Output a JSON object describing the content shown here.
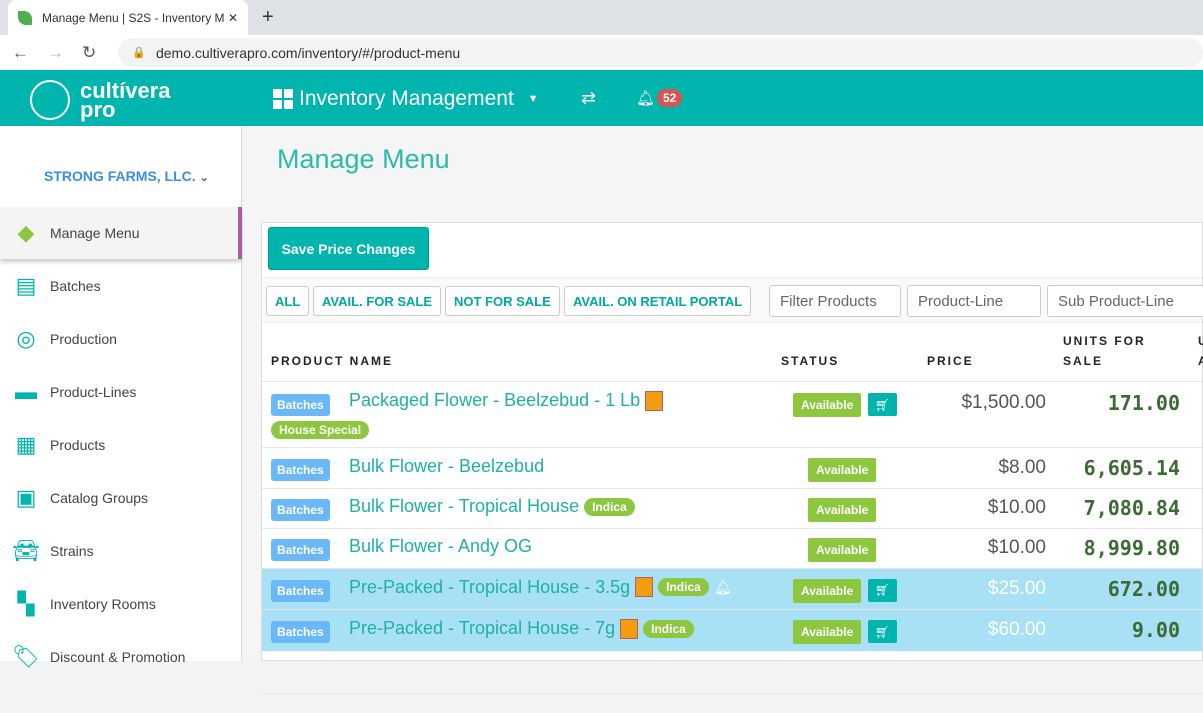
{
  "browser": {
    "tab_title": "Manage Menu | S2S - Inventory M",
    "url": "demo.cultiverapro.com/inventory/#/product-menu"
  },
  "header": {
    "logo_line1": "cultívera",
    "logo_line2": "pro",
    "app_name": "Inventory Management",
    "notification_count": "52"
  },
  "sidebar": {
    "company": "STRONG FARMS, LLC.",
    "items": [
      {
        "label": "Manage Menu",
        "icon": "tag-icon",
        "active": true
      },
      {
        "label": "Batches",
        "icon": "batches-icon"
      },
      {
        "label": "Production",
        "icon": "production-icon"
      },
      {
        "label": "Product-Lines",
        "icon": "product-lines-icon"
      },
      {
        "label": "Products",
        "icon": "products-grid-icon"
      },
      {
        "label": "Catalog Groups",
        "icon": "catalog-icon"
      },
      {
        "label": "Strains",
        "icon": "car-icon"
      },
      {
        "label": "Inventory Rooms",
        "icon": "rooms-icon"
      },
      {
        "label": "Discount & Promotion",
        "icon": "discount-tag-icon"
      }
    ]
  },
  "main": {
    "title": "Manage Menu",
    "save_label": "Save Price Changes",
    "filters": [
      "ALL",
      "AVAIL. FOR SALE",
      "NOT FOR SALE",
      "AVAIL. ON RETAIL PORTAL"
    ],
    "filter_placeholder": "Filter Products",
    "product_line": "Product-Line",
    "sub_product_line": "Sub Product-Line",
    "columns": {
      "name": "PRODUCT NAME",
      "status": "STATUS",
      "price": "PRICE",
      "units1": "UNITS FOR",
      "units2": "SALE",
      "next1": "U",
      "next2": "A"
    },
    "rows": [
      {
        "batches": "Batches",
        "name": "Packaged Flower - Beelzebud - 1 Lb",
        "box": true,
        "tag": "",
        "special": "House Special",
        "status": "Available",
        "cart": true,
        "price": "$1,500.00",
        "units": "171.00"
      },
      {
        "batches": "Batches",
        "name": "Bulk Flower - Beelzebud",
        "status": "Available",
        "price": "$8.00",
        "units": "6,605.14"
      },
      {
        "batches": "Batches",
        "name": "Bulk Flower - Tropical House",
        "tag": "Indica",
        "status": "Available",
        "price": "$10.00",
        "units": "7,080.84"
      },
      {
        "batches": "Batches",
        "name": "Bulk Flower - Andy OG",
        "status": "Available",
        "price": "$10.00",
        "units": "8,999.80"
      },
      {
        "batches": "Batches",
        "name": "Pre-Packed - Tropical House - 3.5g",
        "box": true,
        "tag": "Indica",
        "bell": true,
        "status": "Available",
        "cart": true,
        "price": "$25.00",
        "units": "672.00",
        "highlight": true
      },
      {
        "batches": "Batches",
        "name": "Pre-Packed - Tropical House - 7g",
        "box": true,
        "tag": "Indica",
        "status": "Available",
        "cart": true,
        "price": "$60.00",
        "units": "9.00",
        "highlight": true
      }
    ]
  }
}
